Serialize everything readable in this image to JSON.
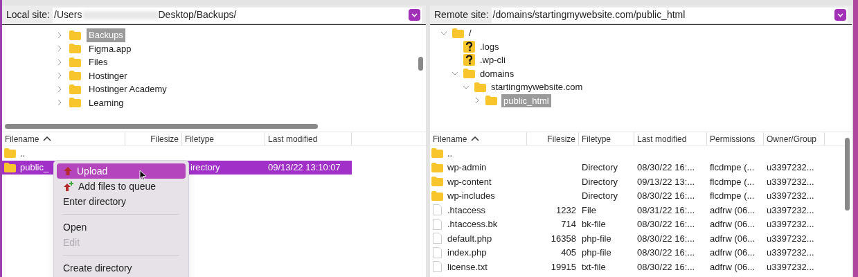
{
  "local": {
    "site_label": "Local site:",
    "path_start": "/Users",
    "path_end": "Desktop/Backups/",
    "tree": [
      {
        "name": "Backups",
        "kind": "folder",
        "expanded": false,
        "selected": true
      },
      {
        "name": "Figma.app",
        "kind": "folder",
        "expanded": false,
        "selected": false
      },
      {
        "name": "Files",
        "kind": "folder",
        "expanded": false,
        "selected": false
      },
      {
        "name": "Hostinger",
        "kind": "folder",
        "expanded": false,
        "selected": false
      },
      {
        "name": "Hostinger Academy",
        "kind": "folder",
        "expanded": false,
        "selected": false
      },
      {
        "name": "Learning",
        "kind": "folder",
        "expanded": false,
        "selected": false
      }
    ],
    "columns": [
      "Filename",
      "Filesize",
      "Filetype",
      "Last modified"
    ],
    "rows": [
      {
        "kind": "folder",
        "selected": false,
        "cells": [
          "..",
          "",
          "",
          ""
        ]
      },
      {
        "kind": "folder",
        "selected": true,
        "cells": [
          "public_",
          "",
          "irectory",
          "09/13/22 13:10:07"
        ]
      }
    ]
  },
  "context_menu": [
    {
      "kind": "upload",
      "label": "Upload",
      "selected": true,
      "disabled": false
    },
    {
      "kind": "queue",
      "label": "Add files to queue",
      "selected": false,
      "disabled": false
    },
    {
      "kind": "item",
      "label": "Enter directory",
      "selected": false,
      "disabled": false
    },
    {
      "kind": "separator"
    },
    {
      "kind": "item",
      "label": "Open",
      "selected": false,
      "disabled": false
    },
    {
      "kind": "item",
      "label": "Edit",
      "selected": false,
      "disabled": true
    },
    {
      "kind": "separator"
    },
    {
      "kind": "item",
      "label": "Create directory",
      "selected": false,
      "disabled": false
    }
  ],
  "remote": {
    "site_label": "Remote site:",
    "path": "/domains/startingmywebsite.com/public_html",
    "tree": [
      {
        "name": "/",
        "kind": "folder",
        "expanded": true,
        "selected": false,
        "children": [
          {
            "name": ".logs",
            "kind": "unknown",
            "selected": false
          },
          {
            "name": ".wp-cli",
            "kind": "unknown",
            "selected": false
          },
          {
            "name": "domains",
            "kind": "folder",
            "expanded": true,
            "selected": false,
            "children": [
              {
                "name": "startingmywebsite.com",
                "kind": "folder",
                "expanded": true,
                "selected": false,
                "children": [
                  {
                    "name": "public_html",
                    "kind": "folder",
                    "expanded": false,
                    "selected": true
                  }
                ]
              }
            ]
          }
        ]
      }
    ],
    "columns": [
      "Filename",
      "Filesize",
      "Filetype",
      "Last modified",
      "Permissions",
      "Owner/Group"
    ],
    "rows": [
      {
        "kind": "folder",
        "cells": [
          "..",
          "",
          "",
          "",
          "",
          ""
        ]
      },
      {
        "kind": "folder",
        "cells": [
          "wp-admin",
          "",
          "Directory",
          "08/30/22 16:...",
          "flcdmpe (...",
          "u3397232..."
        ]
      },
      {
        "kind": "folder",
        "cells": [
          "wp-content",
          "",
          "Directory",
          "09/13/22 13:...",
          "flcdmpe (...",
          "u3397232..."
        ]
      },
      {
        "kind": "folder",
        "cells": [
          "wp-includes",
          "",
          "Directory",
          "08/30/22 16:...",
          "flcdmpe (...",
          "u3397232..."
        ]
      },
      {
        "kind": "file",
        "cells": [
          ".htaccess",
          "1232",
          "File",
          "08/31/22 16:...",
          "adfrw (06...",
          "u3397232..."
        ]
      },
      {
        "kind": "file",
        "cells": [
          ".htaccess.bk",
          "714",
          "bk-file",
          "08/30/22 16:...",
          "adfrw (06...",
          "u3397232..."
        ]
      },
      {
        "kind": "file",
        "cells": [
          "default.php",
          "16358",
          "php-file",
          "08/30/22 16:...",
          "adfrw (06...",
          "u3397232..."
        ]
      },
      {
        "kind": "file",
        "cells": [
          "index.php",
          "405",
          "php-file",
          "08/30/22 16:...",
          "adfrw (06...",
          "u3397232..."
        ]
      },
      {
        "kind": "file",
        "cells": [
          "license.txt",
          "19915",
          "txt-file",
          "08/30/22 16:...",
          "adfrw (06...",
          "u3397232..."
        ]
      }
    ]
  }
}
